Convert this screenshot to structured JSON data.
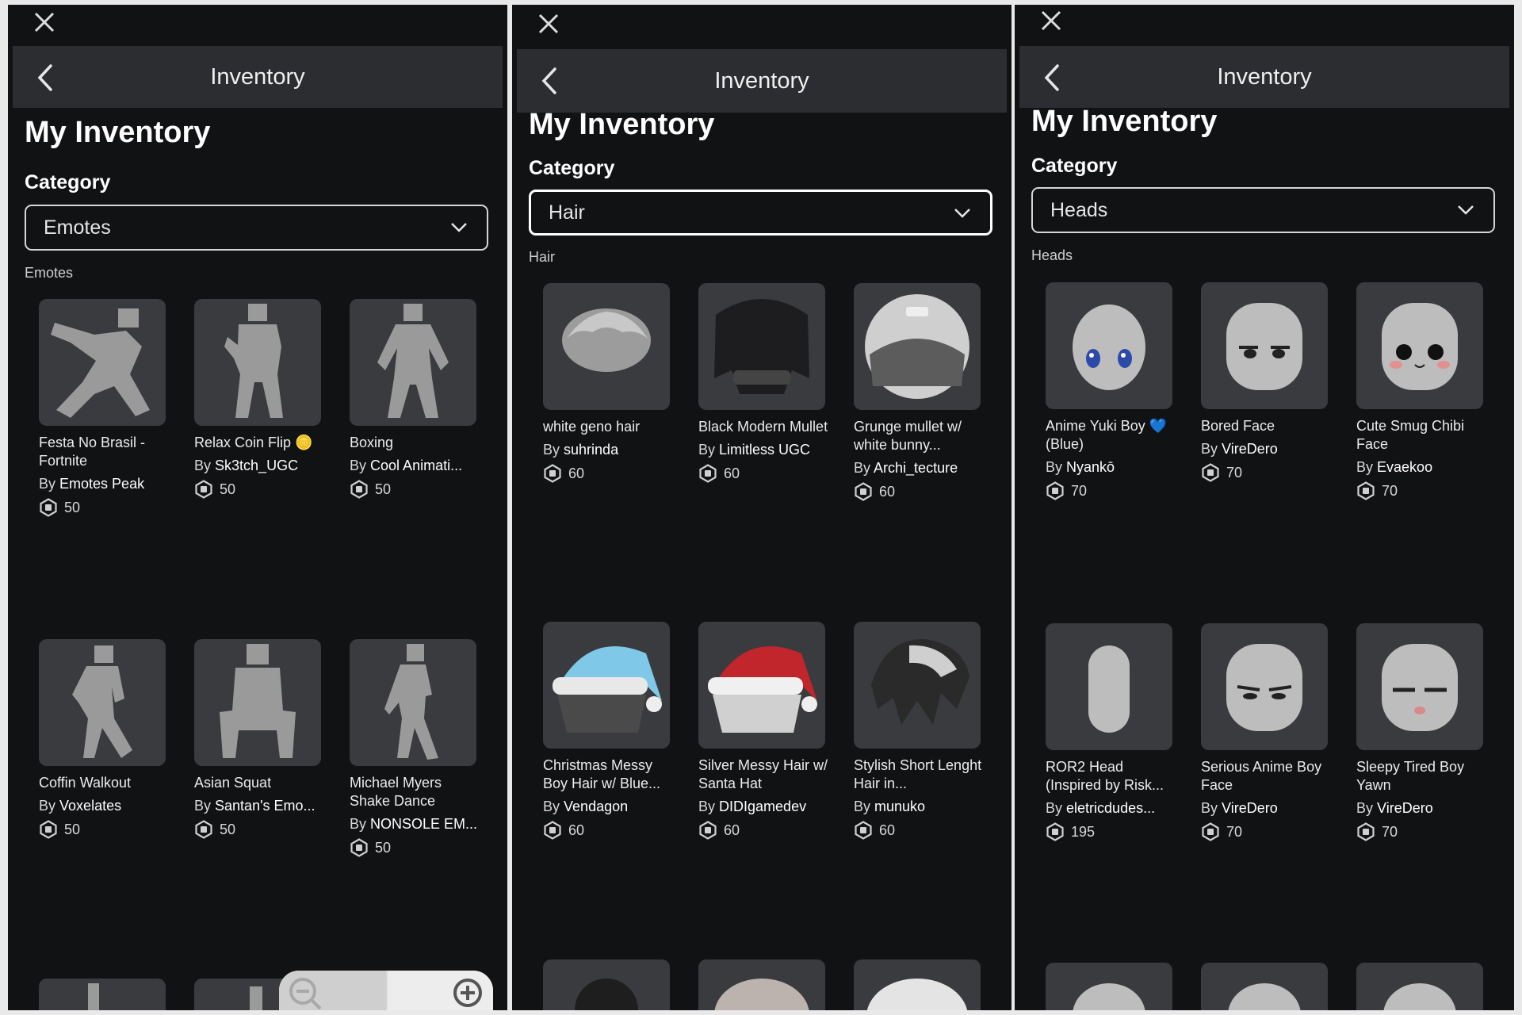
{
  "panels": [
    {
      "nav_title": "Inventory",
      "heading": "My Inventory",
      "category_label": "Category",
      "selected_category": "Emotes",
      "section_label": "Emotes",
      "items": [
        {
          "name": "Festa No Brasil - Fortnite",
          "by": "By",
          "creator": "Emotes Peak",
          "price": "50",
          "icon": "emote-figure-icon"
        },
        {
          "name": "Relax Coin Flip 🪙",
          "by": "By",
          "creator": "Sk3tch_UGC",
          "price": "50",
          "icon": "emote-figure-icon"
        },
        {
          "name": "Boxing",
          "by": "By",
          "creator": "Cool Animati...",
          "price": "50",
          "icon": "emote-figure-icon"
        },
        {
          "name": "Coffin Walkout",
          "by": "By",
          "creator": "Voxelates",
          "price": "50",
          "icon": "emote-figure-icon"
        },
        {
          "name": "Asian Squat",
          "by": "By",
          "creator": "Santan's Emo...",
          "price": "50",
          "icon": "emote-figure-icon"
        },
        {
          "name": "Michael Myers Shake Dance",
          "by": "By",
          "creator": "NONSOLE EM...",
          "price": "50",
          "icon": "emote-figure-icon"
        }
      ]
    },
    {
      "nav_title": "Inventory",
      "heading": "My Inventory",
      "category_label": "Category",
      "selected_category": "Hair",
      "section_label": "Hair",
      "items": [
        {
          "name": "white geno hair",
          "by": "By",
          "creator": "suhrinda",
          "price": "60",
          "icon": "hair-icon"
        },
        {
          "name": "Black Modern Mullet",
          "by": "By",
          "creator": "Limitless UGC",
          "price": "60",
          "icon": "hair-icon"
        },
        {
          "name": "Grunge mullet w/ white bunny...",
          "by": "By",
          "creator": "Archi_tecture",
          "price": "60",
          "icon": "hair-icon"
        },
        {
          "name": "Christmas Messy Boy Hair w/ Blue...",
          "by": "By",
          "creator": "Vendagon",
          "price": "60",
          "icon": "hair-santa-hat-icon"
        },
        {
          "name": "Silver Messy Hair w/ Santa Hat",
          "by": "By",
          "creator": "DIDIgamedev",
          "price": "60",
          "icon": "hair-santa-hat-icon"
        },
        {
          "name": "Stylish Short Lenght Hair in...",
          "by": "By",
          "creator": "munuko",
          "price": "60",
          "icon": "hair-icon"
        }
      ]
    },
    {
      "nav_title": "Inventory",
      "heading": "My Inventory",
      "category_label": "Category",
      "selected_category": "Heads",
      "section_label": "Heads",
      "items": [
        {
          "name": "Anime Yuki Boy 💙(Blue)",
          "by": "By",
          "creator": "Nyankō",
          "price": "70",
          "icon": "head-icon"
        },
        {
          "name": "Bored Face",
          "by": "By",
          "creator": "VireDero",
          "price": "70",
          "icon": "head-icon"
        },
        {
          "name": "Cute Smug Chibi Face",
          "by": "By",
          "creator": "Evaekoo",
          "price": "70",
          "icon": "head-icon"
        },
        {
          "name": "ROR2 Head (Inspired by Risk...",
          "by": "By",
          "creator": "eletricdudes...",
          "price": "195",
          "icon": "head-icon"
        },
        {
          "name": "Serious Anime Boy Face",
          "by": "By",
          "creator": "VireDero",
          "price": "70",
          "icon": "head-icon"
        },
        {
          "name": "Sleepy Tired Boy Yawn",
          "by": "By",
          "creator": "VireDero",
          "price": "70",
          "icon": "head-icon"
        }
      ]
    }
  ],
  "colors": {
    "background": "#111214",
    "navbar": "#2c2d30",
    "thumb": "#393b3f",
    "text": "#ffffff"
  }
}
